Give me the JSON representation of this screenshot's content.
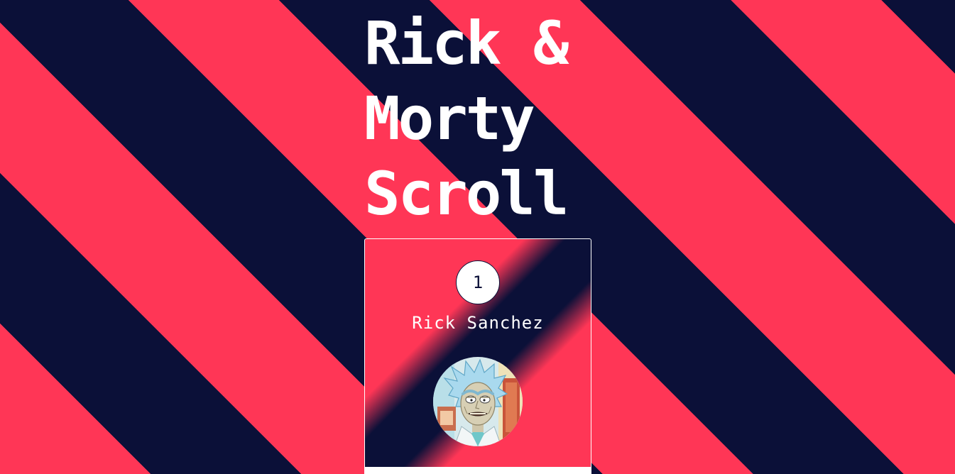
{
  "page": {
    "title_lines": [
      "Rick &",
      "Morty",
      "Scroll"
    ]
  },
  "colors": {
    "stripe_red": "#ff3656",
    "stripe_navy": "#0b1038",
    "text": "#ffffff"
  },
  "character": {
    "id": "1",
    "name": "Rick Sanchez",
    "avatar_icon": "rick-sanchez-avatar"
  }
}
